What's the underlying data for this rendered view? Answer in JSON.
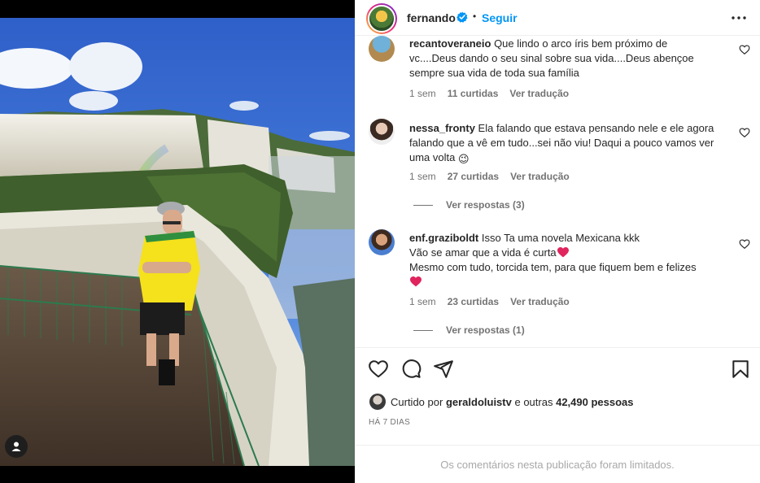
{
  "post": {
    "author": "fernando",
    "separator": "•",
    "follow_label": "Seguir"
  },
  "comments": [
    {
      "user": "recantoveraneio",
      "text": "Que lindo o arco íris bem próximo de vc....Deus dando o seu sinal sobre sua vida....Deus abençoe sempre sua vida de toda sua família",
      "time": "1 sem",
      "likes": "11 curtidas",
      "translate": "Ver tradução"
    },
    {
      "user": "nessa_fronty",
      "text": "Ela falando que estava pensando nele e ele agora falando que a vê em tudo...sei não viu! Daqui a pouco vamos ver uma volta",
      "emoji": "😉",
      "time": "1 sem",
      "likes": "27 curtidas",
      "translate": "Ver tradução",
      "replies": "Ver respostas (3)"
    },
    {
      "user": "enf.graziboldt",
      "line1": "Isso Ta uma novela Mexicana kkk",
      "line2": "Vão se amar que a vida é curta",
      "line3": "Mesmo com tudo, torcida tem, para que fiquem bem e felizes",
      "time": "1 sem",
      "likes": "23 curtidas",
      "translate": "Ver tradução",
      "replies": "Ver respostas (1)"
    }
  ],
  "likes": {
    "prefix": "Curtido por",
    "user": "geraldoluistv",
    "middle": "e outras",
    "count": "42,490",
    "suffix": "pessoas"
  },
  "timestamp": "HÁ 7 DIAS",
  "comments_limited": "Os comentários nesta publicação foram limitados.",
  "colors": {
    "accent": "#0095f6",
    "verified": "#0095f6",
    "muted": "#737373",
    "heart": "#e0245e",
    "shirt": "#f5e11c"
  },
  "icons": {
    "like": "heart-icon",
    "comment": "comment-icon",
    "share": "send-icon",
    "save": "bookmark-icon",
    "more": "more-icon",
    "verified": "verified-badge-icon",
    "tag": "user-tag-icon"
  }
}
